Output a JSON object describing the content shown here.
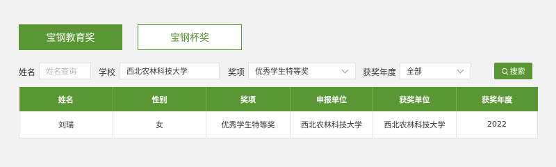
{
  "tabs": [
    {
      "label": "宝钢教育奖",
      "active": true
    },
    {
      "label": "宝钢杯奖",
      "active": false
    }
  ],
  "filters": {
    "name_label": "姓名",
    "name_placeholder": "姓名查询",
    "school_label": "学校",
    "school_value": "西北农林科技大学",
    "award_label": "奖项",
    "award_value": "优秀学生特等奖",
    "year_label": "获奖年度",
    "year_value": "全部",
    "search_label": "搜索"
  },
  "table": {
    "headers": [
      "姓名",
      "性别",
      "奖项",
      "申报单位",
      "获奖单位",
      "获奖年度"
    ],
    "rows": [
      [
        "刘瑞",
        "女",
        "优秀学生特等奖",
        "西北农林科技大学",
        "西北农林科技大学",
        "2022"
      ]
    ]
  },
  "colors": {
    "accent": "#5a9734",
    "background": "#f2f2f2"
  }
}
